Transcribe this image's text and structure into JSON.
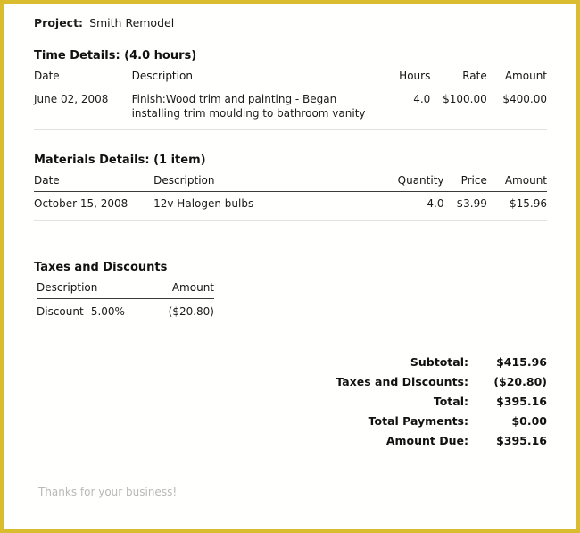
{
  "document": {
    "type": "invoice-detail",
    "border_color": "#d9bd2e",
    "background_color": "#ffffff"
  },
  "project": {
    "label": "Project:",
    "name": "Smith Remodel"
  },
  "time_section": {
    "title": "Time Details: (4.0 hours)",
    "columns": [
      "Date",
      "Description",
      "Hours",
      "Rate",
      "Amount"
    ],
    "rows": [
      {
        "date": "June 02, 2008",
        "description": "Finish:Wood trim and painting - Began installing trim moulding to bathroom vanity",
        "hours": "4.0",
        "rate": "$100.00",
        "amount": "$400.00"
      }
    ]
  },
  "materials_section": {
    "title": "Materials Details: (1 item)",
    "columns": [
      "Date",
      "Description",
      "Quantity",
      "Price",
      "Amount"
    ],
    "rows": [
      {
        "date": "October 15, 2008",
        "description": "12v Halogen bulbs",
        "quantity": "4.0",
        "price": "$3.99",
        "amount": "$15.96"
      }
    ]
  },
  "taxes_section": {
    "title": "Taxes and Discounts",
    "columns": [
      "Description",
      "Amount"
    ],
    "rows": [
      {
        "description": "Discount -5.00%",
        "amount": "($20.80)"
      }
    ]
  },
  "totals": [
    {
      "label": "Subtotal:",
      "value": "$415.96"
    },
    {
      "label": "Taxes and Discounts:",
      "value": "($20.80)"
    },
    {
      "label": "Total:",
      "value": "$395.16"
    },
    {
      "label": "Total Payments:",
      "value": "$0.00"
    },
    {
      "label": "Amount Due:",
      "value": "$395.16"
    }
  ],
  "footer": {
    "note": "Thanks for your business!"
  }
}
